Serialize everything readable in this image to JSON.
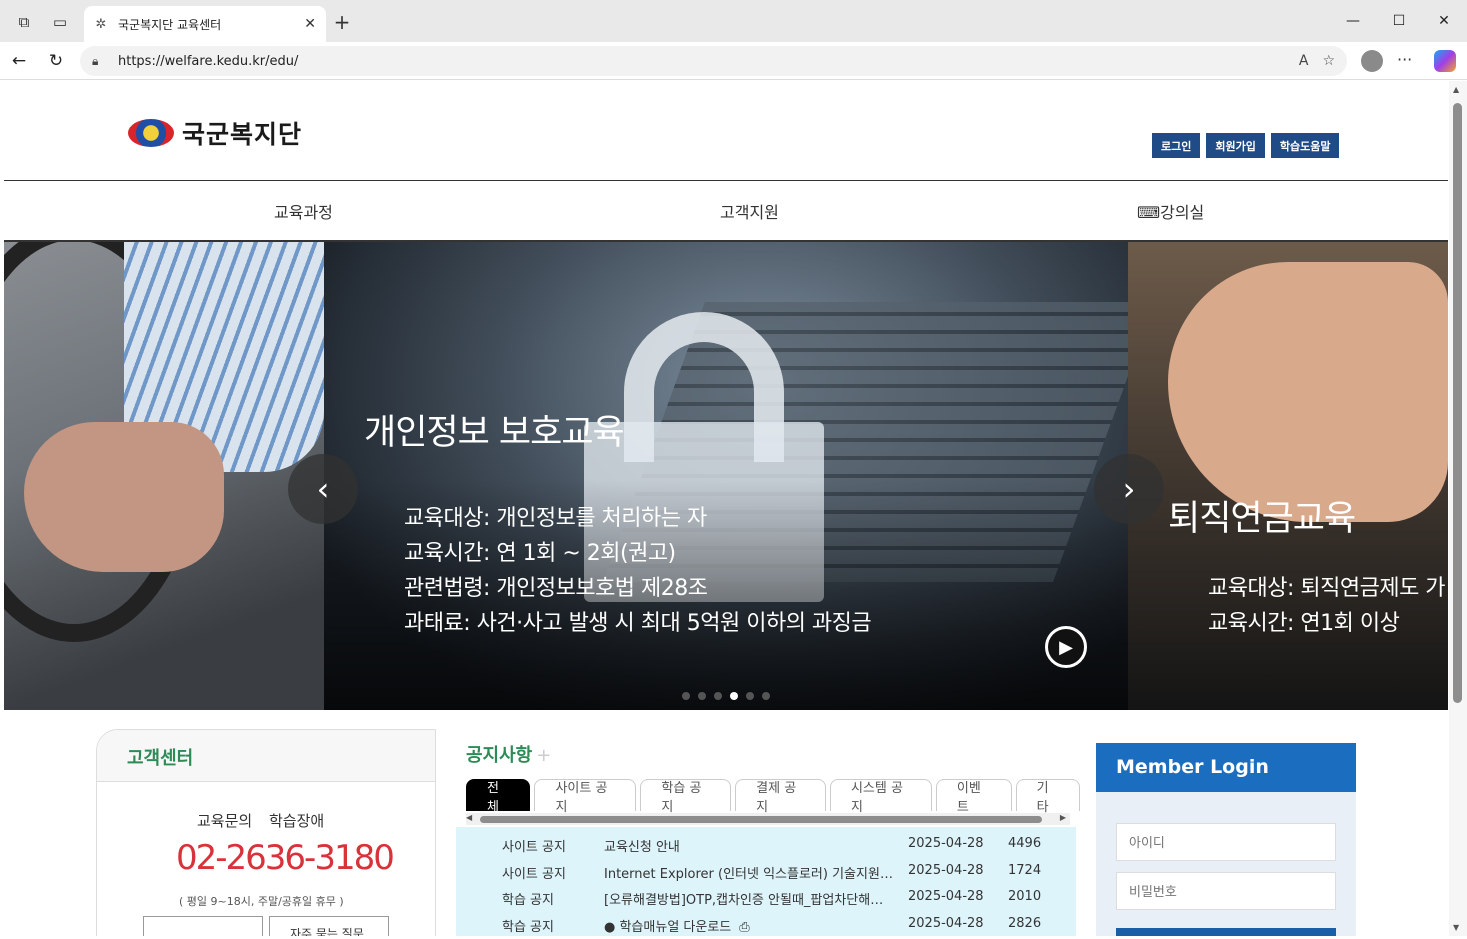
{
  "browser": {
    "tab_title": "국군복지단 교육센터",
    "url": "https://welfare.kedu.kr/edu/",
    "new_tab": "+",
    "close": "✕"
  },
  "site": {
    "logo_text": "국군복지단",
    "top_buttons": [
      "로그인",
      "회원가입",
      "학습도움말"
    ],
    "gnb": [
      "교육과정",
      "고객지원",
      "강의실"
    ]
  },
  "hero": {
    "center": {
      "title": "개인정보 보호교육",
      "lines": [
        "교육대상: 개인정보를 처리하는 자",
        "교육시간: 연 1회 ~ 2회(권고)",
        "관련법령: 개인정보보호법 제28조",
        "과태료: 사건·사고 발생 시 최대 5억원 이하의 과징금"
      ]
    },
    "right": {
      "title": "퇴직연금교육",
      "lines": [
        "교육대상: 퇴직연금제도 가",
        "교육시간: 연1회 이상"
      ]
    },
    "dots_total": 6,
    "dots_active": 4
  },
  "customer_center": {
    "title": "고객센터",
    "labels": "교육문의 학습장애",
    "phone": "02-2636-3180",
    "hours": "( 평일 9~18시, 주말/공휴일 휴무 )",
    "btn2": "자주 묻는 질문"
  },
  "notice": {
    "title": "공지사항",
    "plus": "+",
    "tabs": [
      "전체",
      "사이트 공지",
      "학습 공지",
      "결제 공지",
      "시스템 공지",
      "이벤트",
      "기타"
    ],
    "rows": [
      {
        "cat": "사이트 공지",
        "title": "교육신청 안내",
        "date": "2025-04-28",
        "views": "4496"
      },
      {
        "cat": "사이트 공지",
        "title": "Internet Explorer (인터넷 익스플로러) 기술지원 종료 안내",
        "date": "2025-04-28",
        "views": "1724"
      },
      {
        "cat": "학습 공지",
        "title": "[오류해결방법]OTP,캡차인증 안될때_팝업차단해제 방법",
        "date": "2025-04-28",
        "views": "2010"
      },
      {
        "cat": "학습 공지",
        "title": "● 학습매뉴얼 다운로드",
        "date": "2025-04-28",
        "views": "2826"
      }
    ]
  },
  "member_login": {
    "title": "Member Login",
    "id_placeholder": "아이디",
    "pw_placeholder": "비밀번호"
  }
}
